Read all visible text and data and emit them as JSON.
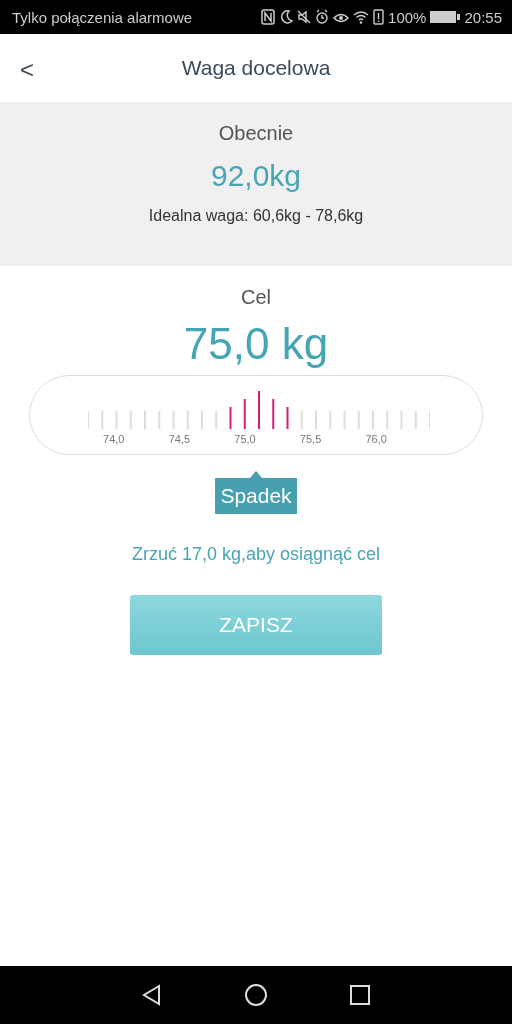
{
  "status_bar": {
    "carrier": "Tylko połączenia alarmowe",
    "battery_text": "100%",
    "time": "20:55"
  },
  "header": {
    "back": "<",
    "title": "Waga docelowa"
  },
  "current": {
    "label": "Obecnie",
    "value": "92,0kg",
    "ideal": "Idealna waga: 60,6kg - 78,6kg"
  },
  "goal": {
    "label": "Cel",
    "value": "75,0 kg",
    "ruler_labels": [
      "74,0",
      "74,5",
      "75,0",
      "75,5",
      "76,0"
    ],
    "tag": "Spadek",
    "message": "Zrzuć 17,0 kg,aby osiągnąć cel"
  },
  "save_button": "ZAPISZ"
}
